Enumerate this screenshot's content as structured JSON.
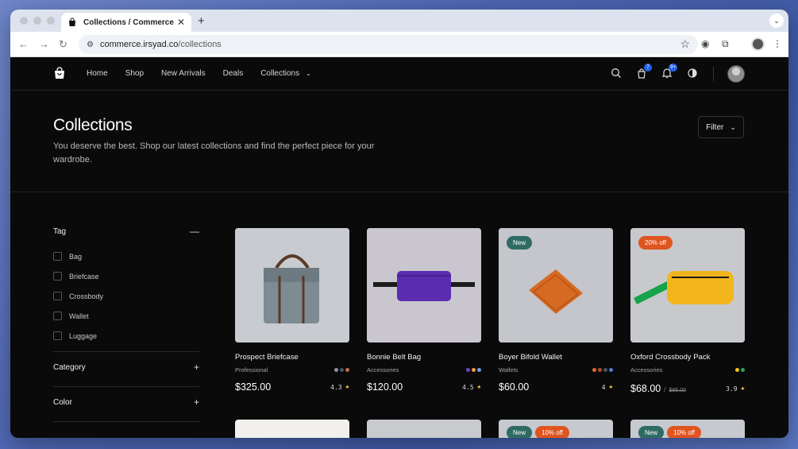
{
  "browser": {
    "tab_title": "Collections / Commerce",
    "new_tab": "+",
    "url_host": "commerce.irsyad.co",
    "url_path": "/collections"
  },
  "nav": {
    "items": [
      "Home",
      "Shop",
      "New Arrivals",
      "Deals",
      "Collections"
    ],
    "cart_count": "7",
    "notif_count": "9+"
  },
  "hero": {
    "title": "Collections",
    "subtitle": "You deserve the best. Shop our latest collections and find the perfect piece for your wardrobe.",
    "filter_label": "Filter"
  },
  "sidebar": {
    "tag_heading": "Tag",
    "tags": [
      "Bag",
      "Briefcase",
      "Crossbody",
      "Wallet",
      "Luggage"
    ],
    "category_heading": "Category",
    "color_heading": "Color"
  },
  "products": [
    {
      "name": "Prospect Briefcase",
      "category": "Professional",
      "price": "$325.00",
      "rating": "4.3",
      "swatches": [
        "#8a95a6",
        "#4b5563",
        "#c2703f"
      ]
    },
    {
      "name": "Bonnie Belt Bag",
      "category": "Accessories",
      "price": "$120.00",
      "rating": "4.5",
      "swatches": [
        "#6d3fc7",
        "#f39c3d",
        "#6aa0e0"
      ]
    },
    {
      "name": "Boyer Bifold Wallet",
      "category": "Wallets",
      "price": "$60.00",
      "rating": "4",
      "badge": "New",
      "swatches": [
        "#e26a2c",
        "#b34a2a",
        "#4b5563",
        "#4f7bd6"
      ]
    },
    {
      "name": "Oxford Crossbody Pack",
      "category": "Accessories",
      "price": "$68.00",
      "old_price": "$85.00",
      "rating": "3.9",
      "badge_off": "20% off",
      "swatches": [
        "#f4c21a",
        "#2ea44f"
      ]
    }
  ],
  "row2": [
    {
      "badges": []
    },
    {
      "badges": []
    },
    {
      "badge_new": "New",
      "badge_off": "10% off"
    },
    {
      "badge_new": "New",
      "badge_off": "10% off"
    }
  ],
  "colors": {
    "accent_badge": "#2563eb",
    "new_pill": "#2f6b63",
    "off_pill": "#e0541f",
    "star": "#f6c744"
  }
}
